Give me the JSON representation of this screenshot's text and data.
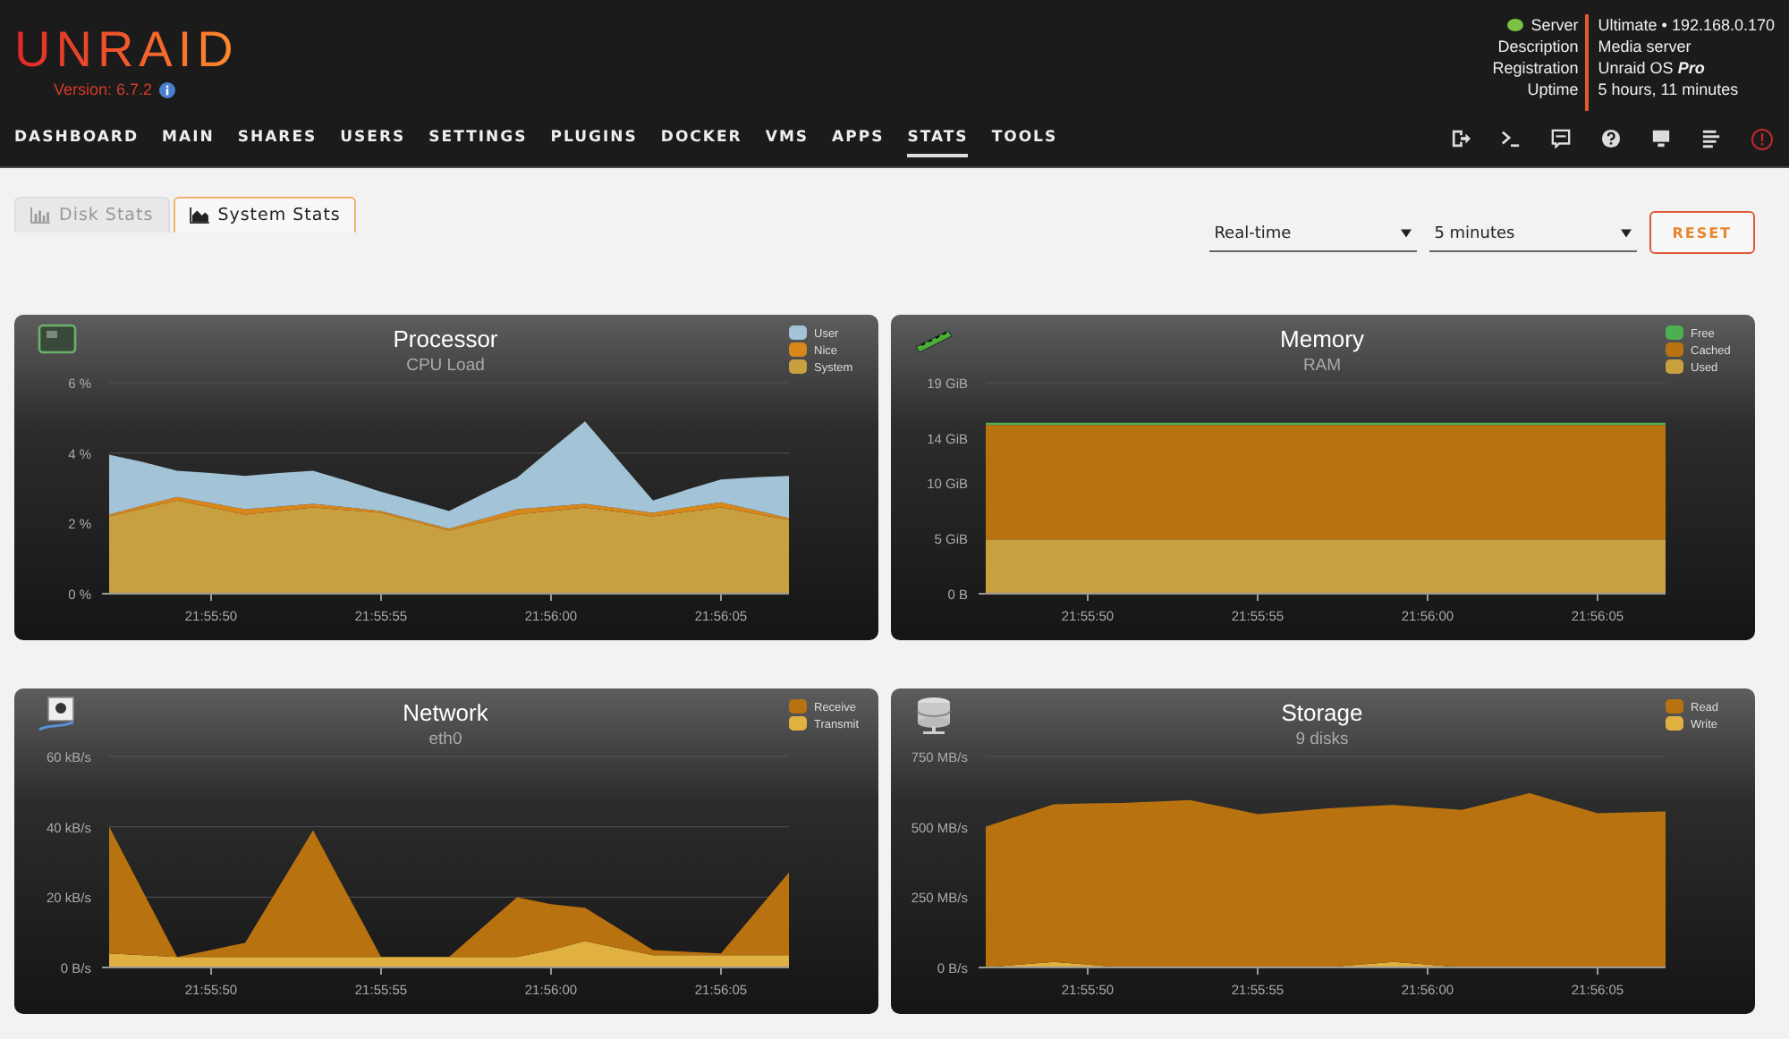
{
  "header": {
    "logo": "UNRAID",
    "version": "Version: 6.7.2",
    "info": [
      {
        "label": "Server",
        "value": "Ultimate • 192.168.0.170"
      },
      {
        "label": "Description",
        "value": "Media server"
      },
      {
        "label": "Registration",
        "value": "Unraid OS **Pro**"
      },
      {
        "label": "Uptime",
        "value": "5 hours, 11 minutes"
      }
    ]
  },
  "nav": [
    {
      "label": "DASHBOARD",
      "selected": false
    },
    {
      "label": "MAIN",
      "selected": false
    },
    {
      "label": "SHARES",
      "selected": false
    },
    {
      "label": "USERS",
      "selected": false
    },
    {
      "label": "SETTINGS",
      "selected": false
    },
    {
      "label": "PLUGINS",
      "selected": false
    },
    {
      "label": "DOCKER",
      "selected": false
    },
    {
      "label": "VMS",
      "selected": false
    },
    {
      "label": "APPS",
      "selected": false
    },
    {
      "label": "STATS",
      "selected": true
    },
    {
      "label": "TOOLS",
      "selected": false
    }
  ],
  "tabs": [
    {
      "label": "Disk Stats",
      "selected": false
    },
    {
      "label": "System Stats",
      "selected": true
    }
  ],
  "controls": {
    "mode": "Real-time",
    "range": "5 minutes",
    "reset": "RESET"
  },
  "panels": [
    {
      "title": "Processor",
      "subtitle": "CPU Load",
      "chart_data": {
        "type": "area",
        "legend": "top-right",
        "stacked": true,
        "categories": [
          null,
          null,
          null,
          "21:55:50",
          null,
          null,
          null,
          null,
          "21:55:55",
          null,
          null,
          null,
          null,
          "21:56:00",
          null,
          null,
          null,
          null,
          "21:56:05",
          null,
          null
        ],
        "ylim": [
          0,
          6
        ],
        "yticks": [
          {
            "value": 0,
            "label": "0 %"
          },
          {
            "value": 2,
            "label": "2 %"
          },
          {
            "value": 4,
            "label": "4 %"
          },
          {
            "value": 6,
            "label": "6 %"
          }
        ],
        "series": [
          {
            "name": "User",
            "color": "#a3c3d6",
            "values": [
              1.7,
              1.23,
              0.75,
              0.85,
              0.95,
              0.95,
              0.95,
              0.75,
              0.55,
              0.53,
              0.5,
              0.7,
              0.9,
              1.63,
              2.35,
              1.35,
              0.35,
              0.5,
              0.65,
              0.93,
              1.2
            ]
          },
          {
            "name": "Nice",
            "color": "#d9861a",
            "values": [
              0.05,
              0.08,
              0.1,
              0.13,
              0.15,
              0.13,
              0.1,
              0.08,
              0.05,
              0.05,
              0.05,
              0.1,
              0.15,
              0.13,
              0.1,
              0.1,
              0.1,
              0.13,
              0.15,
              0.1,
              0.05
            ]
          },
          {
            "name": "System",
            "color": "#c9a040",
            "values": [
              2.2,
              2.43,
              2.65,
              2.45,
              2.25,
              2.35,
              2.45,
              2.38,
              2.3,
              2.05,
              1.8,
              2.03,
              2.25,
              2.35,
              2.45,
              2.33,
              2.2,
              2.33,
              2.45,
              2.28,
              2.1
            ]
          }
        ]
      }
    },
    {
      "title": "Memory",
      "subtitle": "RAM",
      "chart_data": {
        "type": "area",
        "legend": "top-right",
        "stacked": true,
        "categories": [
          null,
          null,
          null,
          "21:55:50",
          null,
          null,
          null,
          null,
          "21:55:55",
          null,
          null,
          null,
          null,
          "21:56:00",
          null,
          null,
          null,
          null,
          "21:56:05",
          null,
          null
        ],
        "ylim": [
          0,
          19
        ],
        "yticks": [
          {
            "value": 0,
            "label": "0 B"
          },
          {
            "value": 5,
            "label": "5 GiB"
          },
          {
            "value": 10,
            "label": "10 GiB"
          },
          {
            "value": 14,
            "label": "14 GiB"
          },
          {
            "value": 19,
            "label": "19 GiB"
          }
        ],
        "series": [
          {
            "name": "Free",
            "color": "#4caf50",
            "values": [
              0.2,
              0.2,
              0.2,
              0.2,
              0.2,
              0.2,
              0.2,
              0.2,
              0.2,
              0.2,
              0.2,
              0.2,
              0.2,
              0.2,
              0.2,
              0.2,
              0.2,
              0.2,
              0.2,
              0.2,
              0.2
            ]
          },
          {
            "name": "Cached",
            "color": "#b8720f",
            "values": [
              10.3,
              10.3,
              10.3,
              10.3,
              10.3,
              10.3,
              10.3,
              10.3,
              10.3,
              10.3,
              10.3,
              10.3,
              10.3,
              10.3,
              10.3,
              10.3,
              10.3,
              10.3,
              10.3,
              10.3,
              10.3
            ]
          },
          {
            "name": "Used",
            "color": "#c9a040",
            "values": [
              4.9,
              4.9,
              4.9,
              4.9,
              4.9,
              4.9,
              4.9,
              4.9,
              4.9,
              4.9,
              4.9,
              4.9,
              4.9,
              4.9,
              4.9,
              4.9,
              4.9,
              4.9,
              4.9,
              4.9,
              4.9
            ]
          }
        ]
      }
    },
    {
      "title": "Network",
      "subtitle": "eth0",
      "chart_data": {
        "type": "area",
        "legend": "top-right",
        "stacked": true,
        "categories": [
          null,
          null,
          null,
          "21:55:50",
          null,
          null,
          null,
          null,
          "21:55:55",
          null,
          null,
          null,
          null,
          "21:56:00",
          null,
          null,
          null,
          null,
          "21:56:05",
          null,
          null
        ],
        "ylim": [
          0,
          60
        ],
        "yticks": [
          {
            "value": 0,
            "label": "0 B/s"
          },
          {
            "value": 20,
            "label": "20 kB/s"
          },
          {
            "value": 40,
            "label": "40 kB/s"
          },
          {
            "value": 60,
            "label": "60 kB/s"
          }
        ],
        "series": [
          {
            "name": "Receive",
            "color": "#b8720f",
            "values": [
              36,
              18,
              0,
              2,
              4,
              20,
              36,
              18,
              0,
              0,
              0,
              8.5,
              17,
              13,
              9.5,
              5.5,
              1.5,
              1,
              0.5,
              12,
              23.5
            ]
          },
          {
            "name": "Transmit",
            "color": "#e0b040",
            "values": [
              4,
              3.5,
              3,
              3,
              3,
              3,
              3,
              3,
              3,
              3,
              3,
              3,
              3,
              5,
              7.5,
              5.5,
              3.5,
              3.5,
              3.5,
              3.5,
              3.5
            ]
          }
        ]
      }
    },
    {
      "title": "Storage",
      "subtitle": "9 disks",
      "chart_data": {
        "type": "area",
        "legend": "top-right",
        "stacked": true,
        "categories": [
          null,
          null,
          null,
          "21:55:50",
          null,
          null,
          null,
          null,
          "21:55:55",
          null,
          null,
          null,
          null,
          "21:56:00",
          null,
          null,
          null,
          null,
          "21:56:05",
          null,
          null
        ],
        "ylim": [
          0,
          750
        ],
        "yticks": [
          {
            "value": 0,
            "label": "0 B/s"
          },
          {
            "value": 250,
            "label": "250 MB/s"
          },
          {
            "value": 500,
            "label": "500 MB/s"
          },
          {
            "value": 750,
            "label": "750 MB/s"
          }
        ],
        "series": [
          {
            "name": "Read",
            "color": "#b8720f",
            "values": [
              500,
              530,
              560,
              573,
              585,
              590,
              595,
              570,
              545,
              555,
              565,
              562,
              558,
              559,
              560,
              590,
              620,
              584,
              548,
              552,
              555
            ]
          },
          {
            "name": "Write",
            "color": "#e0b040",
            "values": [
              0,
              10,
              20,
              10,
              0,
              0,
              0,
              0,
              0,
              0,
              0,
              10,
              20,
              10,
              0,
              0,
              0,
              0,
              0,
              0,
              0
            ]
          }
        ]
      }
    }
  ]
}
